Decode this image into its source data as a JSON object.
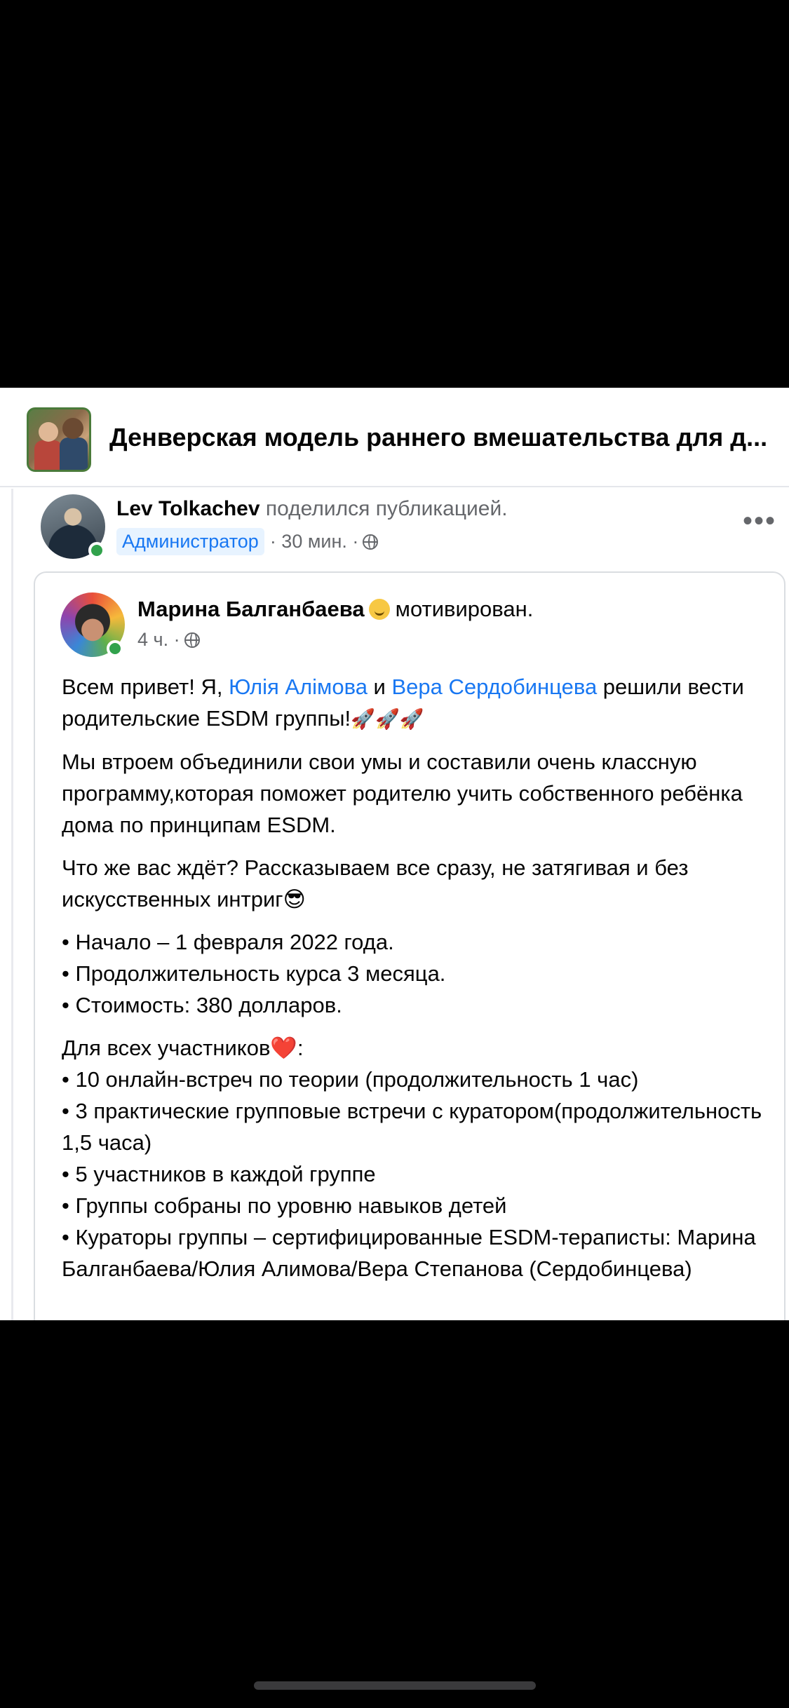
{
  "group": {
    "title": "Денверская модель раннего вмешательства для д..."
  },
  "share": {
    "author": "Lev Tolkachev",
    "action": "поделился публикацией.",
    "role": "Администратор",
    "time": "· 30 мин. ·",
    "more": "•••"
  },
  "post": {
    "author": "Марина Балганбаева",
    "mood": "мотивирован.",
    "time": "4 ч. ·",
    "p1_a": "Всем привет! Я, ",
    "p1_link1": "Юлія Алімова",
    "p1_b": " и ",
    "p1_link2": "Вера Сердобинцева",
    "p1_c": "  решили вести родительские ESDM группы!",
    "p1_emoji": "🚀🚀🚀",
    "p2": "Мы втроем объединили свои умы и составили очень классную программу,которая поможет родителю учить собственного ребёнка дома по принципам ESDM.",
    "p3": "Что же вас ждёт? Рассказываем все сразу, не затягивая и без искусственных интриг",
    "p3_emoji": "😎",
    "facts": [
      "• Начало –  1 февраля 2022 года.",
      "• Продолжительность курса 3 месяца.",
      "• Стоимость: 380 долларов."
    ],
    "list_title": "Для всех участников",
    "list_title_emoji": "❤️",
    "list_title_end": ":",
    "items": [
      "•  10 онлайн-встреч по теории (продолжительность 1 час)",
      "•  3 практические групповые встречи с куратором(продолжительность 1,5 часа)",
      "•  5 участников в каждой группе",
      "•  Группы собраны по уровню навыков детей",
      "•  Кураторы группы – сертифицированные ESDM-тераписты: Марина Балганбаева/Юлия Алимова/Вера Степанова (Сердобинцева)"
    ]
  }
}
